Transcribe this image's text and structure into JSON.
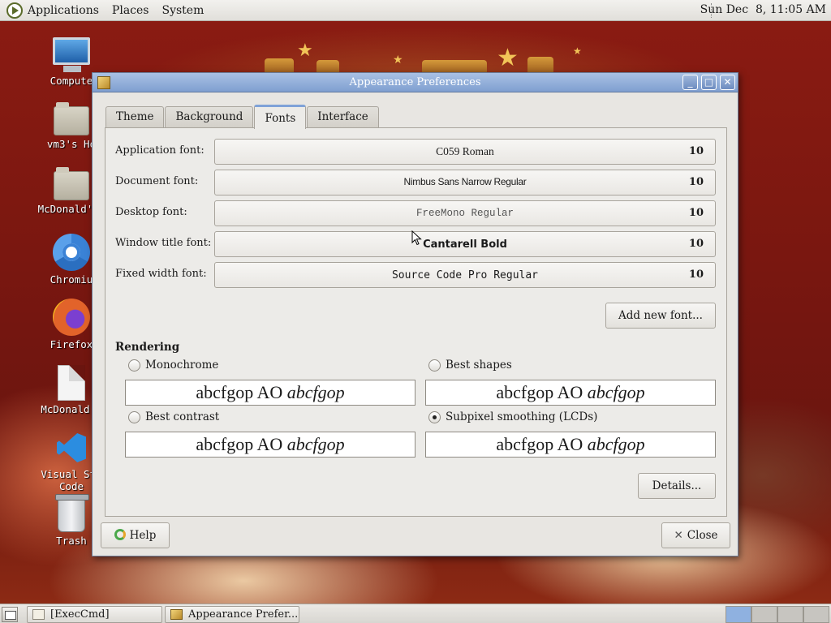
{
  "top_panel": {
    "applications": "Applications",
    "places": "Places",
    "system": "System",
    "clock": "Sun Dec  8, 11:05 AM"
  },
  "desktop_icons": [
    {
      "label": "Compute",
      "icon": "computer-icon"
    },
    {
      "label": "vm3's Ho",
      "icon": "home-folder-icon"
    },
    {
      "label": "McDonald's_",
      "icon": "folder-icon"
    },
    {
      "label": "Chromiu",
      "icon": "chromium-icon"
    },
    {
      "label": "Firefox",
      "icon": "firefox-icon"
    },
    {
      "label": "McDonald's",
      "icon": "document-icon"
    },
    {
      "label": "Visual Stu",
      "label2": "Code",
      "icon": "vscode-icon"
    },
    {
      "label": "Trash",
      "icon": "trash-icon"
    }
  ],
  "window": {
    "title": "Appearance Preferences",
    "tabs": [
      "Theme",
      "Background",
      "Fonts",
      "Interface"
    ],
    "active_tab": "Fonts",
    "fonts": [
      {
        "label": "Application font:",
        "name": "C059 Roman",
        "size": "10"
      },
      {
        "label": "Document font:",
        "name": "Nimbus Sans Narrow Regular",
        "size": "10"
      },
      {
        "label": "Desktop font:",
        "name": "FreeMono Regular",
        "size": "10"
      },
      {
        "label": "Window title font:",
        "name": "Cantarell Bold",
        "size": "10"
      },
      {
        "label": "Fixed width font:",
        "name": "Source Code Pro Regular",
        "size": "10"
      }
    ],
    "add_font_label": "Add new font...",
    "rendering": {
      "title": "Rendering",
      "options": [
        {
          "label": "Monochrome",
          "checked": false
        },
        {
          "label": "Best shapes",
          "checked": false
        },
        {
          "label": "Best contrast",
          "checked": false
        },
        {
          "label": "Subpixel smoothing (LCDs)",
          "checked": true
        }
      ],
      "preview_plain": "abcfgop AO ",
      "preview_italic": "abcfgop"
    },
    "details_label": "Details...",
    "help_label": "Help",
    "close_label": "Close"
  },
  "taskbar": {
    "items": [
      "[ExecCmd]",
      "Appearance Prefer..."
    ]
  },
  "colors": {
    "titlebar": "#7f9fd0",
    "desktop": "#7a1710",
    "active_tab_accent": "#7fa2d8"
  }
}
